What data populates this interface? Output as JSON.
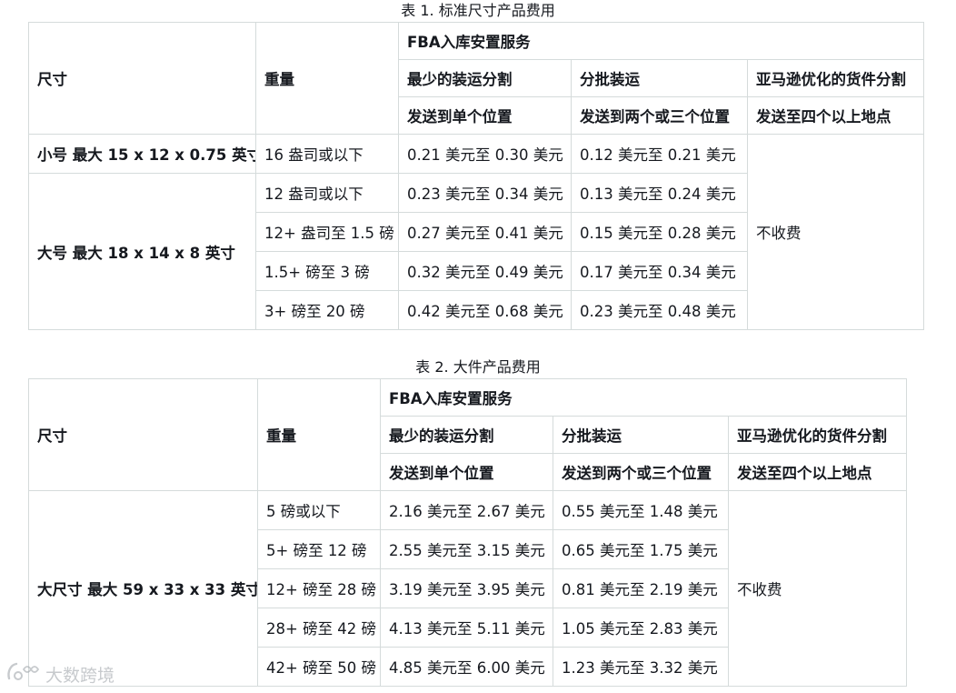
{
  "header_labels": {
    "size": "尺寸",
    "weight": "重量",
    "service_group": "FBA入库安置服务",
    "col_minimal": "最少的装运分割",
    "col_partial": "分批装运",
    "col_optimized": "亚马逊优化的货件分割",
    "sub_minimal": "发送到单个位置",
    "sub_partial": "发送到两个或三个位置",
    "sub_optimized": "发送至四个以上地点"
  },
  "table1": {
    "caption": "表 1. 标准尺寸产品费用",
    "no_charge": "不收费",
    "groups": [
      {
        "size_label": "小号 最大 15 x 12 x 0.75 英寸",
        "rows": [
          {
            "weight": "16 盎司或以下",
            "minimal": "0.21 美元至 0.30 美元",
            "partial": "0.12 美元至 0.21 美元"
          }
        ]
      },
      {
        "size_label": "大号 最大 18 x 14 x 8 英寸",
        "rows": [
          {
            "weight": "12 盎司或以下",
            "minimal": "0.23 美元至 0.34 美元",
            "partial": "0.13 美元至 0.24 美元"
          },
          {
            "weight": "12+ 盎司至 1.5 磅",
            "minimal": "0.27 美元至 0.41 美元",
            "partial": "0.15 美元至 0.28 美元"
          },
          {
            "weight": "1.5+ 磅至 3 磅",
            "minimal": "0.32 美元至 0.49 美元",
            "partial": "0.17 美元至 0.34 美元"
          },
          {
            "weight": "3+ 磅至 20 磅",
            "minimal": "0.42 美元至 0.68 美元",
            "partial": "0.23 美元至 0.48 美元"
          }
        ]
      }
    ]
  },
  "table2": {
    "caption": "表 2. 大件产品费用",
    "no_charge": "不收费",
    "groups": [
      {
        "size_label": "大尺寸 最大 59 x 33 x 33 英寸",
        "rows": [
          {
            "weight": "5 磅或以下",
            "minimal": "2.16 美元至 2.67 美元",
            "partial": "0.55 美元至 1.48 美元"
          },
          {
            "weight": "5+ 磅至 12 磅",
            "minimal": "2.55 美元至 3.15 美元",
            "partial": "0.65 美元至 1.75 美元"
          },
          {
            "weight": "12+ 磅至 28 磅",
            "minimal": "3.19 美元至 3.95 美元",
            "partial": "0.81 美元至 2.19 美元"
          },
          {
            "weight": "28+ 磅至 42 磅",
            "minimal": "4.13 美元至 5.11 美元",
            "partial": "1.05 美元至 2.83 美元"
          },
          {
            "weight": "42+ 磅至 50 磅",
            "minimal": "4.85 美元至 6.00 美元",
            "partial": "1.23 美元至 3.32 美元"
          }
        ]
      }
    ]
  },
  "watermark": {
    "text": "大数跨境",
    "icon": "brand-logo-icon"
  }
}
